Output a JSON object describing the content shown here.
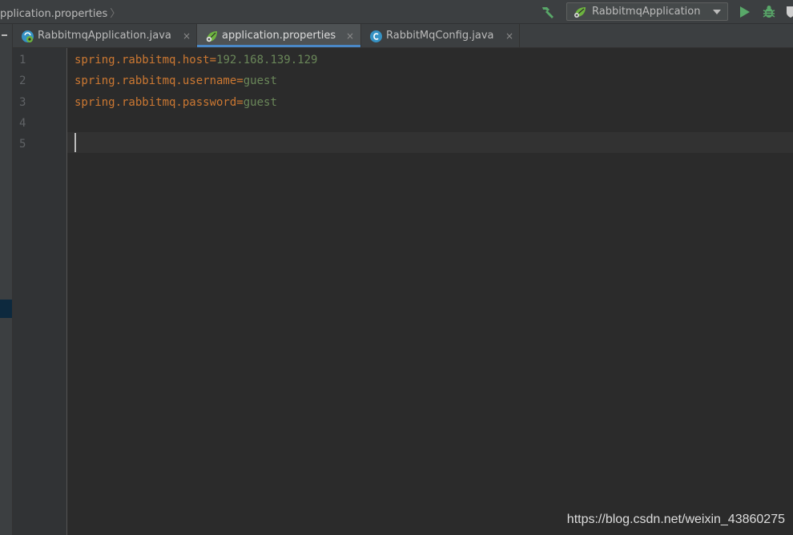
{
  "navbar": {
    "breadcrumb": "pplication.properties",
    "breadcrumb_sep": "〉",
    "run_config": "RabbitmqApplication"
  },
  "tabs": [
    {
      "label": "RabbitmqApplication.java",
      "icon": "spring-class-icon",
      "active": false
    },
    {
      "label": "application.properties",
      "icon": "spring-leaf-icon",
      "active": true
    },
    {
      "label": "RabbitMqConfig.java",
      "icon": "class-c-icon",
      "active": false
    }
  ],
  "close_glyph": "×",
  "editor": {
    "line_numbers": [
      "1",
      "2",
      "3",
      "4",
      "5"
    ],
    "lines": [
      {
        "key": "spring.rabbitmq.host",
        "eq": "=",
        "value": "192.168.139.129"
      },
      {
        "key": "spring.rabbitmq.username",
        "eq": "=",
        "value": "guest"
      },
      {
        "key": "spring.rabbitmq.password",
        "eq": "=",
        "value": "guest"
      }
    ],
    "caret_line": 5
  },
  "colors": {
    "background": "#2b2b2b",
    "key": "#cc7832",
    "value": "#6a8759",
    "accent": "#4a88c7",
    "run_green": "#59a869"
  },
  "watermark": "https://blog.csdn.net/weixin_43860275"
}
